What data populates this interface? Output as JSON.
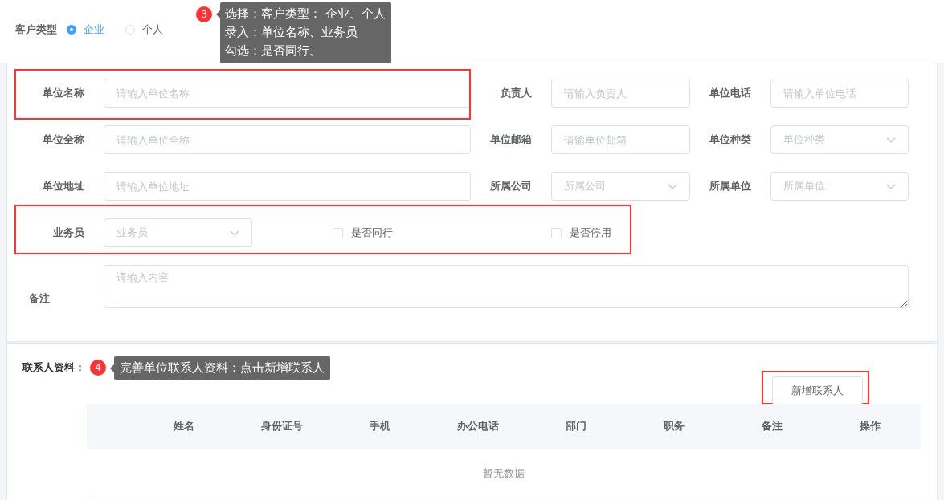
{
  "customer_type": {
    "label": "客户类型",
    "options": [
      {
        "label": "企业",
        "selected": true
      },
      {
        "label": "个人",
        "selected": false
      }
    ]
  },
  "tip_top": {
    "number": "3",
    "lines": [
      "选择：客户类型：  企业、个人",
      "录入：单位名称、业务员",
      "勾选：是否同行、"
    ]
  },
  "form": {
    "rows": [
      [
        {
          "label": "单位名称",
          "kind": "input",
          "placeholder": "请输入单位名称"
        },
        {
          "label": "负责人",
          "kind": "input",
          "placeholder": "请输入负责人"
        },
        {
          "label": "单位电话",
          "kind": "input",
          "placeholder": "请输入单位电话"
        }
      ],
      [
        {
          "label": "单位全称",
          "kind": "input",
          "placeholder": "请输入单位全称"
        },
        {
          "label": "单位邮箱",
          "kind": "input",
          "placeholder": "请输单位邮箱"
        },
        {
          "label": "单位种类",
          "kind": "select",
          "placeholder": "单位种类"
        }
      ],
      [
        {
          "label": "单位地址",
          "kind": "input",
          "placeholder": "请输入单位地址"
        },
        {
          "label": "所属公司",
          "kind": "select",
          "placeholder": "所属公司"
        },
        {
          "label": "所属单位",
          "kind": "select",
          "placeholder": "所属单位"
        }
      ]
    ],
    "salesman": {
      "label": "业务员",
      "kind": "select",
      "placeholder": "业务员"
    },
    "checkboxes": [
      {
        "label": "是否同行",
        "checked": false
      },
      {
        "label": "是否停用",
        "checked": false
      }
    ],
    "remark": {
      "label": "备注",
      "kind": "textarea",
      "placeholder": "请输入内容"
    }
  },
  "contacts": {
    "label": "联系人资料：",
    "tip": {
      "number": "4",
      "lines": [
        "完善单位联系人资料：点击新增联系人"
      ]
    },
    "add_button": "新增联系人",
    "table": {
      "columns": [
        "姓名",
        "身份证号",
        "手机",
        "办公电话",
        "部门",
        "职务",
        "备注",
        "操作"
      ],
      "empty_text": "暂无数据"
    }
  }
}
